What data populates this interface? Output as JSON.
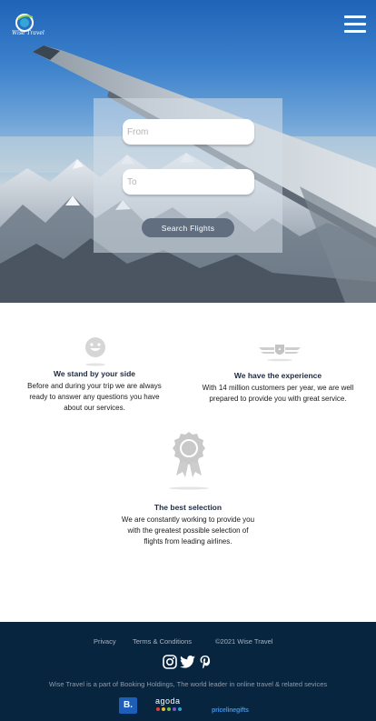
{
  "header": {
    "logo_text": "Wise Travel",
    "menu_icon": "hamburger-menu-icon"
  },
  "search": {
    "from_placeholder": "From",
    "to_placeholder": "To",
    "button_label": "Search  Flights"
  },
  "features": [
    {
      "icon": "smiley-face-icon",
      "title": "We stand by your side",
      "description": "Before and during your trip we are always ready to answer any questions you have about our services."
    },
    {
      "icon": "winged-shield-icon",
      "title": "We have the experience",
      "description": "With 14 million customers per year, we are well prepared to provide you with great service."
    },
    {
      "icon": "award-ribbon-icon",
      "title": "The best selection",
      "description": "We are constantly working to provide you with the greatest possible selection of flights from leading airlines."
    }
  ],
  "footer": {
    "links": [
      "Privacy",
      "Terms & Conditions",
      "©2021 Wise Travel"
    ],
    "social_icons": [
      "instagram-icon",
      "twitter-icon",
      "pinterest-icon"
    ],
    "tagline": "Wise Travel is a part of Booking Holdings, The world leader in online travel & related sevices",
    "partners": {
      "booking": "B.",
      "agoda": "agoda",
      "priceline": "pricelinegifts"
    }
  },
  "colors": {
    "footer_bg": "#08253f",
    "search_button": "#606e80",
    "feature_title": "#1e2a40"
  }
}
